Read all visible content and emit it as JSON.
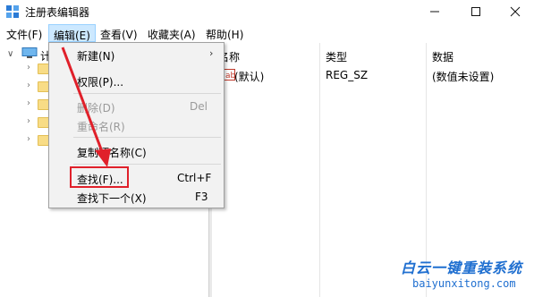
{
  "window": {
    "title": "注册表编辑器",
    "icons": {
      "app": "regedit-icon",
      "minimize": "minimize-icon",
      "maximize": "maximize-icon",
      "close": "close-icon"
    }
  },
  "menubar": {
    "file": "文件(F)",
    "edit": "编辑(E)",
    "view": "查看(V)",
    "favorites": "收藏夹(A)",
    "help": "帮助(H)"
  },
  "tree": {
    "root_label": "计",
    "root_icon": "computer-icon",
    "child_icon": "folder-icon"
  },
  "list": {
    "columns": [
      "名称",
      "类型",
      "数据"
    ],
    "rows": [
      {
        "name": "(默认)",
        "type": "REG_SZ",
        "data": "(数值未设置)",
        "icon": "string-value-icon"
      }
    ]
  },
  "edit_menu": {
    "new": "新建(N)",
    "permissions": "权限(P)...",
    "delete": "删除(D)",
    "delete_shortcut": "Del",
    "rename": "重命名(R)",
    "copy_key_name": "复制项名称(C)",
    "find": "查找(F)...",
    "find_shortcut": "Ctrl+F",
    "find_next": "查找下一个(X)",
    "find_next_shortcut": "F3"
  },
  "annotation": {
    "highlight_color": "#e0202a",
    "arrow_color": "#e0202a"
  },
  "watermark": {
    "main": "白云一键重装系统",
    "url": "baiyunxitong.com",
    "color": "#1f6fd0"
  }
}
